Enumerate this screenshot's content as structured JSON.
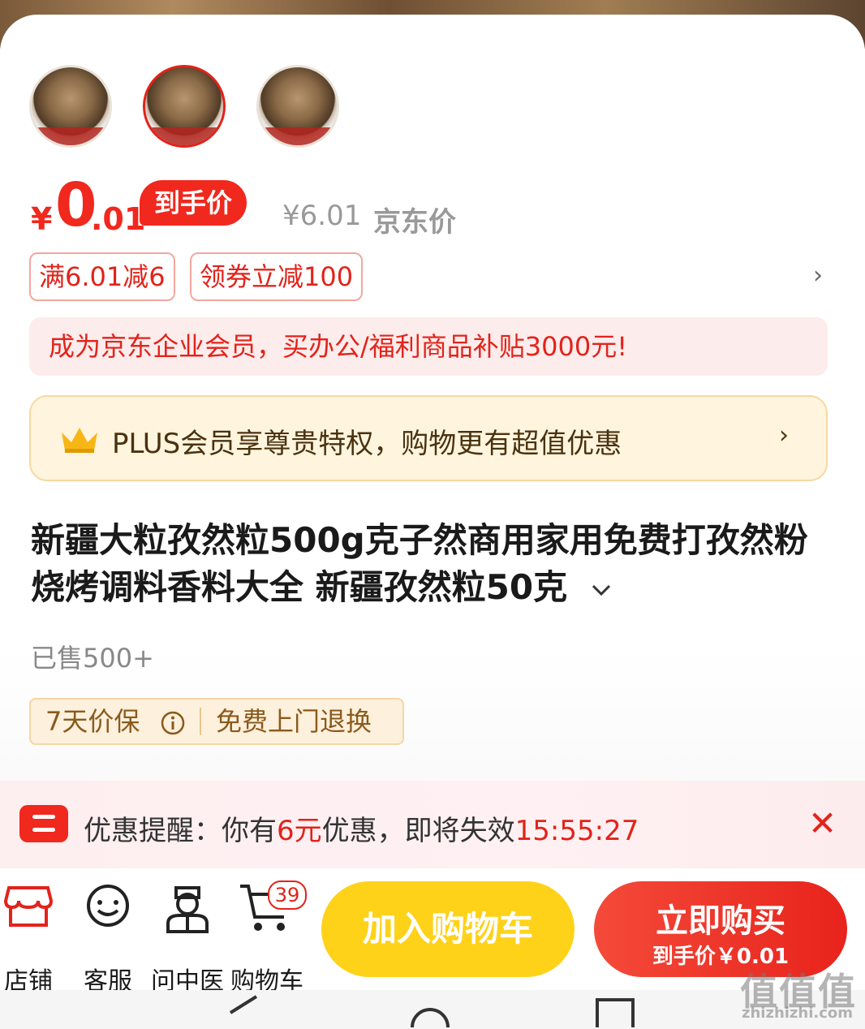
{
  "price": {
    "currency": "¥",
    "integer": "0",
    "decimal": ".01",
    "tag": "到手价",
    "jd_price": "¥6.01",
    "jd_label": "京东价"
  },
  "coupons": [
    "满6.01减6",
    "领券立减100"
  ],
  "enterprise_banner": "成为京东企业会员，买办公/福利商品补贴3000元!",
  "plus_banner": "PLUS会员享尊贵特权，购物更有超值优惠",
  "product": {
    "title": "新疆大粒孜然粒500g克子然商用家用免费打孜然粉烧烤调料香料大全 新疆孜然粒50克",
    "sold": "已售500+"
  },
  "guarantee": {
    "price_protect": "7天价保",
    "free_return": "免费上门退换"
  },
  "reminder": {
    "prefix": "优惠提醒：你有",
    "amount": "6元",
    "middle": "优惠，即将失效",
    "countdown": "15:55:27"
  },
  "bottom_bar": {
    "shop": "店铺",
    "service": "客服",
    "doctor": "问中医",
    "cart": "购物车",
    "cart_count": "39",
    "add_to_cart": "加入购物车",
    "buy_now": "立即购买",
    "buy_sub": "到手价￥0.01"
  },
  "watermark": {
    "logo": "值值值",
    "site": "zhizhizhi.com"
  },
  "colors": {
    "brand_red": "#f0281e",
    "cart_yellow": "#ffd21a"
  }
}
